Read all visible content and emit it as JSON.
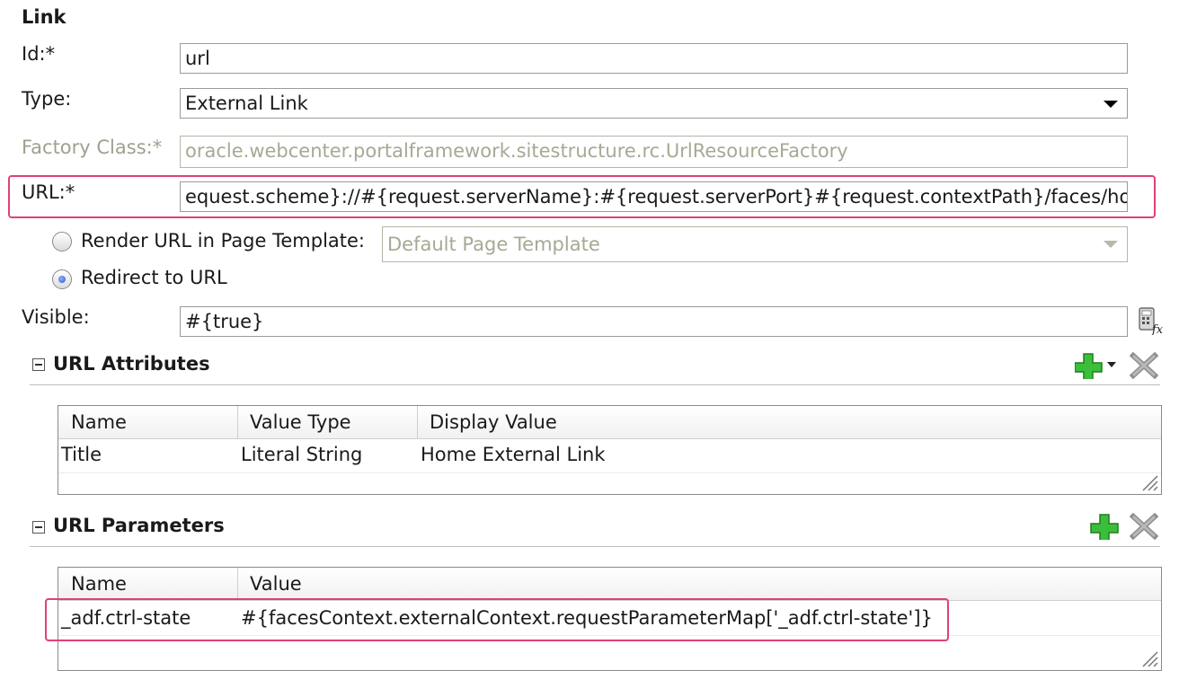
{
  "section": {
    "title": "Link"
  },
  "form": {
    "id": {
      "label": "Id:*",
      "value": "url"
    },
    "type": {
      "label": "Type:",
      "value": "External Link"
    },
    "factory_class": {
      "label": "Factory Class:*",
      "value": "oracle.webcenter.portalframework.sitestructure.rc.UrlResourceFactory"
    },
    "url": {
      "label": "URL:*",
      "value": "equest.scheme}://#{request.serverName}:#{request.serverPort}#{request.contextPath}/faces/hom"
    },
    "render_in_template": {
      "label": "Render URL in Page Template:",
      "selected": false,
      "template_value": "Default Page Template"
    },
    "redirect": {
      "label": "Redirect to URL",
      "selected": true
    },
    "visible": {
      "label": "Visible:",
      "value": "#{true}"
    }
  },
  "url_attributes": {
    "title": "URL Attributes",
    "columns": [
      "Name",
      "Value Type",
      "Display Value"
    ],
    "rows": [
      {
        "name": "Title",
        "value_type": "Literal String",
        "display_value": "Home External Link"
      }
    ]
  },
  "url_parameters": {
    "title": "URL Parameters",
    "columns": [
      "Name",
      "Value"
    ],
    "rows": [
      {
        "name": "_adf.ctrl-state",
        "value": "#{facesContext.externalContext.requestParameterMap['_adf.ctrl-state']}"
      }
    ]
  },
  "icons": {
    "expression_builder": "expression-builder-icon",
    "add": "green-plus-icon",
    "delete": "gray-x-icon",
    "collapse": "collapse-minus-icon"
  },
  "colors": {
    "highlight": "#e0407a",
    "add_green": "#2fae2f",
    "delete_gray": "#9a9a9a"
  }
}
